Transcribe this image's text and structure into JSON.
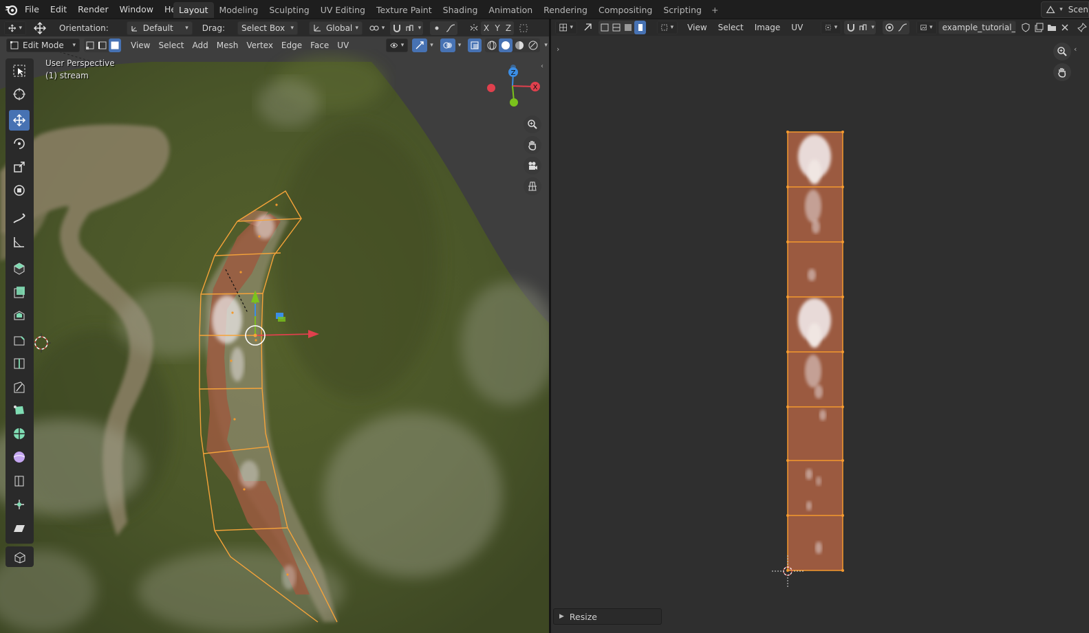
{
  "app": {
    "menu": [
      "File",
      "Edit",
      "Render",
      "Window",
      "Help"
    ],
    "workspaces": [
      "Layout",
      "Modeling",
      "Sculpting",
      "UV Editing",
      "Texture Paint",
      "Shading",
      "Animation",
      "Rendering",
      "Compositing",
      "Scripting"
    ],
    "active_workspace": "Layout",
    "add_workspace": "+",
    "scene_label": "Scen"
  },
  "tool_header": {
    "orientation_label": "Orientation:",
    "orientation_value": "Default",
    "drag_label": "Drag:",
    "drag_value": "Select Box",
    "transform_orientation": "Global",
    "axis_x": "X",
    "axis_y": "Y",
    "axis_z": "Z"
  },
  "viewport_header": {
    "mode": "Edit Mode",
    "menus": [
      "View",
      "Select",
      "Add",
      "Mesh",
      "Vertex",
      "Edge",
      "Face",
      "UV"
    ]
  },
  "viewport": {
    "perspective": "User Perspective",
    "object": "(1) stream",
    "gizmo_x": "X",
    "gizmo_y": "Y",
    "gizmo_z": "Z"
  },
  "uv_editor": {
    "menus": [
      "View",
      "Select",
      "Image",
      "UV"
    ],
    "image_name": "example_tutorial_st...",
    "operator_panel": "Resize"
  },
  "colors": {
    "selection_orange": "#f5a33a",
    "active_blue": "#4772b3",
    "face_brown": "#9b5a40",
    "axis_red": "#e0404d",
    "axis_green": "#7bc31c",
    "axis_blue": "#3b8ee6"
  }
}
